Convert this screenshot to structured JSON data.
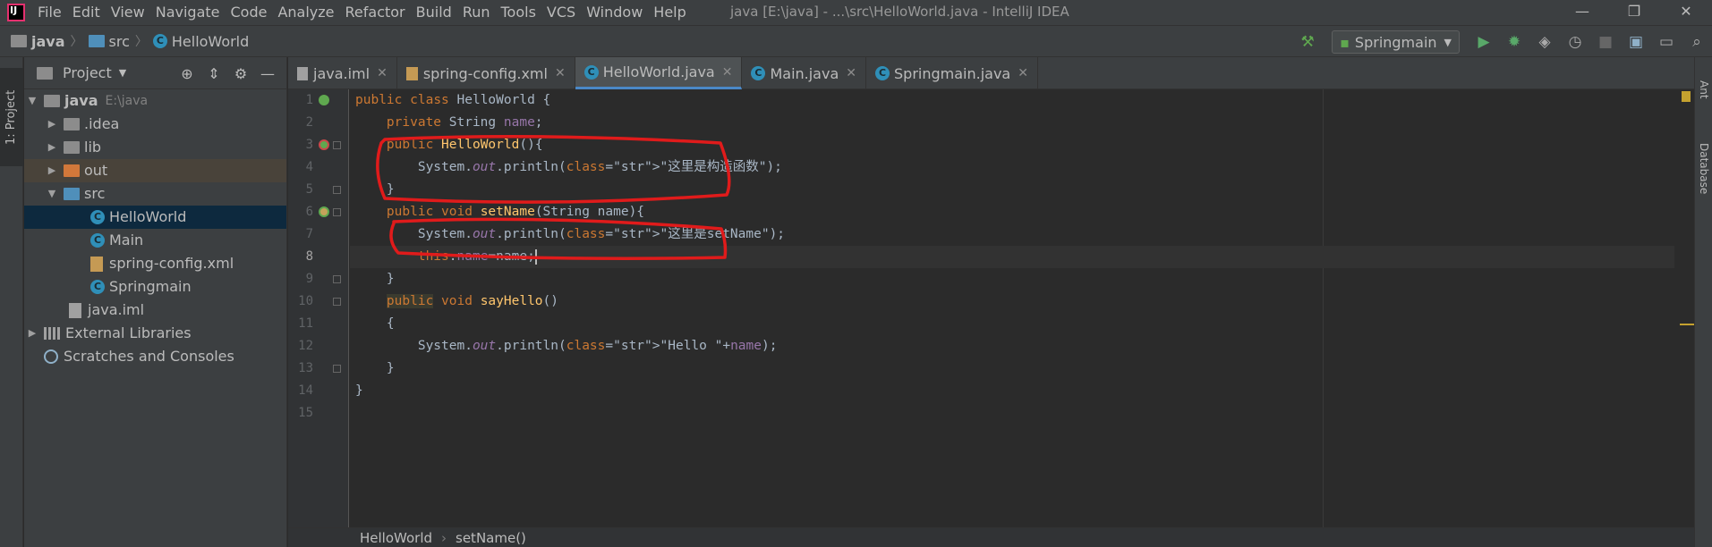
{
  "menu": [
    "File",
    "Edit",
    "View",
    "Navigate",
    "Code",
    "Analyze",
    "Refactor",
    "Build",
    "Run",
    "Tools",
    "VCS",
    "Window",
    "Help"
  ],
  "window_title": "java [E:\\java] - ...\\src\\HelloWorld.java - IntelliJ IDEA",
  "window_controls": [
    "—",
    "❐",
    "✕"
  ],
  "breadcrumb": [
    "java",
    "src",
    "HelloWorld"
  ],
  "run_config": "Springmain",
  "left_tool_tab": "1: Project",
  "right_tool_tabs": [
    "Ant",
    "Database"
  ],
  "project_panel": {
    "title": "Project",
    "tree": [
      {
        "label": "java",
        "hint": "E:\\java",
        "depth": 0,
        "arrow": "▼",
        "icon": "folder"
      },
      {
        "label": ".idea",
        "depth": 1,
        "arrow": "▶",
        "icon": "folder"
      },
      {
        "label": "lib",
        "depth": 1,
        "arrow": "▶",
        "icon": "folder"
      },
      {
        "label": "out",
        "depth": 1,
        "arrow": "▶",
        "icon": "folder-orange"
      },
      {
        "label": "src",
        "depth": 1,
        "arrow": "▼",
        "icon": "folder-blue"
      },
      {
        "label": "HelloWorld",
        "depth": 2,
        "icon": "class"
      },
      {
        "label": "Main",
        "depth": 2,
        "icon": "class"
      },
      {
        "label": "spring-config.xml",
        "depth": 2,
        "icon": "xml"
      },
      {
        "label": "Springmain",
        "depth": 2,
        "icon": "class"
      },
      {
        "label": "java.iml",
        "depth": 1,
        "icon": "file"
      },
      {
        "label": "External Libraries",
        "depth": 0,
        "arrow": "▶",
        "icon": "lib"
      },
      {
        "label": "Scratches and Consoles",
        "depth": 0,
        "icon": "scratch"
      }
    ]
  },
  "tabs": [
    {
      "label": "java.iml",
      "icon": "file"
    },
    {
      "label": "spring-config.xml",
      "icon": "xml"
    },
    {
      "label": "HelloWorld.java",
      "icon": "class",
      "active": true
    },
    {
      "label": "Main.java",
      "icon": "class"
    },
    {
      "label": "Springmain.java",
      "icon": "class"
    }
  ],
  "code_lines": [
    "public class HelloWorld {",
    "    private String name;",
    "    public HelloWorld(){",
    "        System.out.println(\"这里是构造函数\");",
    "    }",
    "    public void setName(String name){",
    "        System.out.println(\"这里是setName\");",
    "        this.name=name;",
    "    }",
    "    public void sayHello()",
    "    {",
    "        System.out.println(\"Hello \"+name);",
    "    }",
    "}",
    ""
  ],
  "code_breadcrumb": [
    "HelloWorld",
    "setName()"
  ],
  "colors": {
    "keyword": "#cc7832",
    "string": "#6a8759",
    "method": "#ffc66d",
    "field": "#9876aa",
    "annotation": "#e01b1b"
  }
}
